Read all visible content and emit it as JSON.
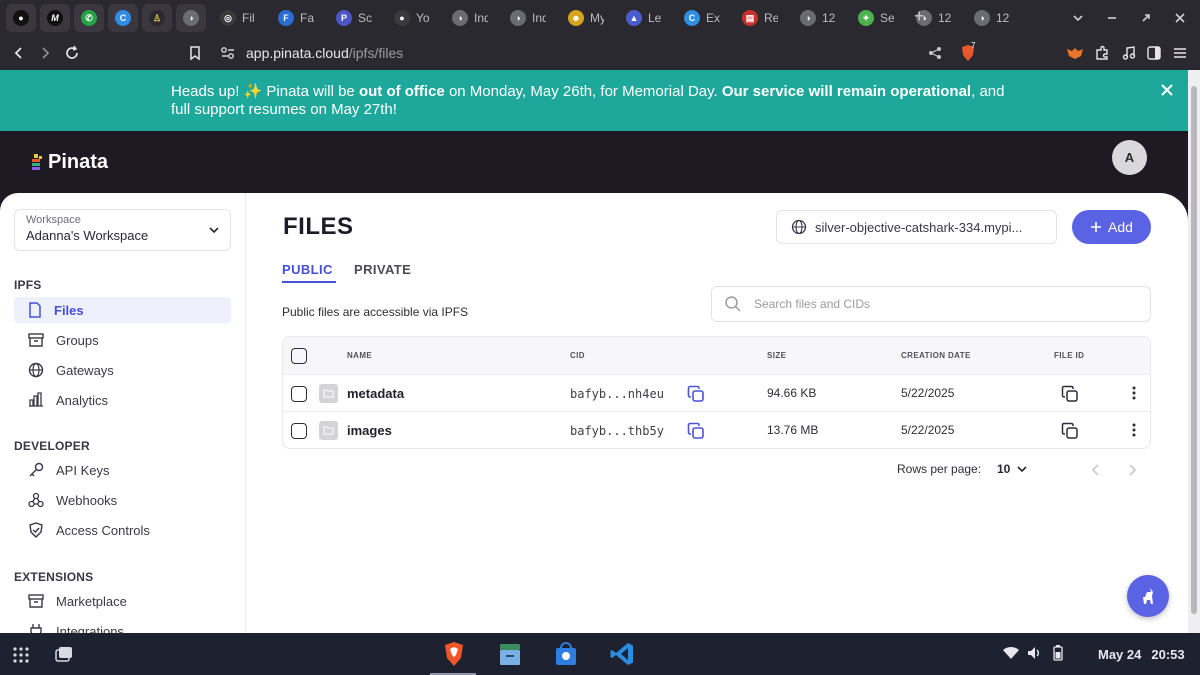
{
  "browser": {
    "tabs": [
      {
        "label": "Fil",
        "color": "#3a3a3a",
        "glyph": "◎"
      },
      {
        "label": "Fav",
        "color": "#2a6bd6",
        "glyph": "F"
      },
      {
        "label": "Sc",
        "color": "#4b56c8",
        "glyph": "P"
      },
      {
        "label": "Yo",
        "color": "#3a3a3a",
        "glyph": "●"
      },
      {
        "label": "Ind",
        "color": "#6b6b72",
        "glyph": "◑"
      },
      {
        "label": "Ind",
        "color": "#6b6b72",
        "glyph": "◑"
      },
      {
        "label": "My",
        "color": "#d4a41c",
        "glyph": "☻"
      },
      {
        "label": "Let",
        "color": "#4b5bd0",
        "glyph": "▲"
      },
      {
        "label": "Ex",
        "color": "#2f8de4",
        "glyph": "C"
      },
      {
        "label": "Re",
        "color": "#c9302c",
        "glyph": "▤"
      },
      {
        "label": "12",
        "color": "#6b6b72",
        "glyph": "◑"
      },
      {
        "label": "Se",
        "color": "#4bb34b",
        "glyph": "✦"
      },
      {
        "label": "12",
        "color": "#6b6b72",
        "glyph": "◑"
      },
      {
        "label": "12",
        "color": "#6b6b72",
        "glyph": "◑"
      }
    ],
    "url_host": "app.pinata.cloud",
    "url_path": "/ipfs/files",
    "shield_badge": "7"
  },
  "banner": {
    "part1": "Heads up! ✨ Pinata will be ",
    "bold1": "out of office",
    "part2": " on Monday, May 26th, for Memorial Day. ",
    "bold2": "Our service will remain operational",
    "part3": ", and",
    "line2": "full support resumes on May 27th!"
  },
  "header": {
    "brand": "Pinata",
    "avatar_initial": "A"
  },
  "sidebar": {
    "workspace_caption": "Workspace",
    "workspace_name": "Adanna's Workspace",
    "sections": {
      "ipfs": "IPFS",
      "developer": "DEVELOPER",
      "extensions": "EXTENSIONS"
    },
    "items": {
      "files": "Files",
      "groups": "Groups",
      "gateways": "Gateways",
      "analytics": "Analytics",
      "api_keys": "API Keys",
      "webhooks": "Webhooks",
      "access_controls": "Access Controls",
      "marketplace": "Marketplace",
      "integrations": "Integrations"
    }
  },
  "main": {
    "title": "FILES",
    "gateway": "silver-objective-catshark-334.mypi...",
    "add_label": "Add",
    "tab_public": "PUBLIC",
    "tab_private": "PRIVATE",
    "subtitle": "Public files are accessible via IPFS",
    "search_placeholder": "Search files and CIDs",
    "columns": {
      "name": "NAME",
      "cid": "CID",
      "size": "SIZE",
      "creation_date": "CREATION DATE",
      "file_id": "FILE ID"
    },
    "rows": [
      {
        "name": "metadata",
        "cid": "bafyb...nh4eu",
        "size": "94.66 KB",
        "date": "5/22/2025"
      },
      {
        "name": "images",
        "cid": "bafyb...thb5y",
        "size": "13.76 MB",
        "date": "5/22/2025"
      }
    ],
    "rows_per_page_label": "Rows per page:",
    "rows_per_page_value": "10"
  },
  "taskbar": {
    "date": "May 24",
    "time": "20:53"
  },
  "colors": {
    "accent": "#5a63e3",
    "banner": "#1ea89b",
    "header": "#1e1a24"
  }
}
